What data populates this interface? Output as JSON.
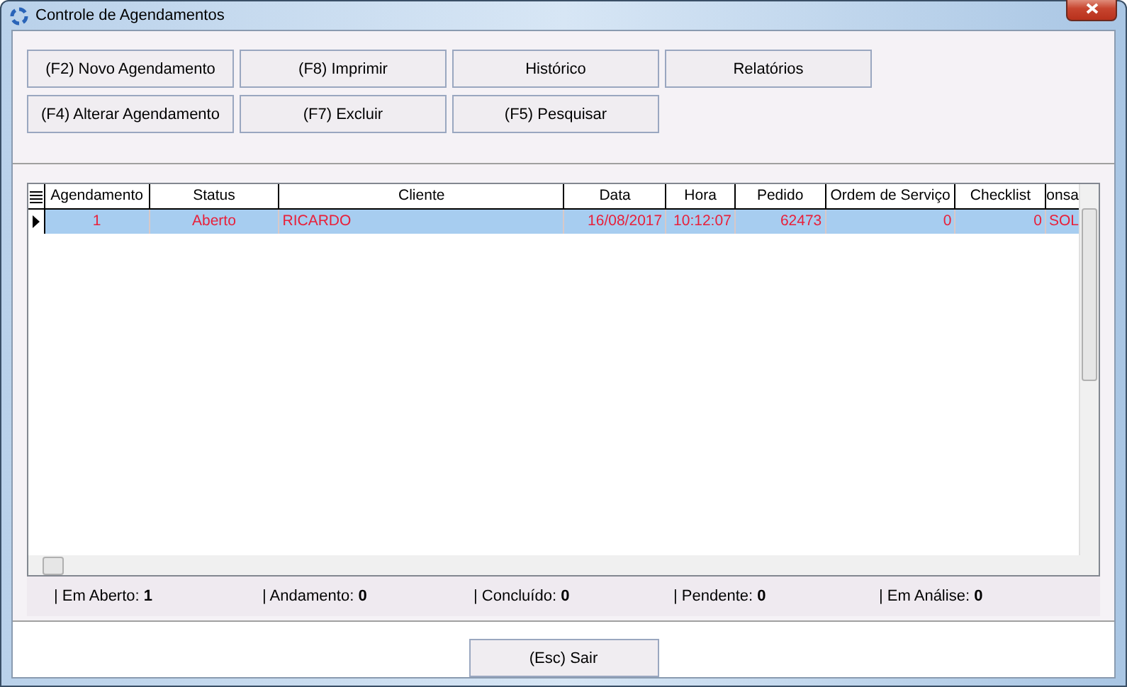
{
  "window": {
    "title": "Controle de Agendamentos"
  },
  "toolbar": [
    [
      {
        "label": "(F2) Novo Agendamento"
      },
      {
        "label": "(F8) Imprimir"
      },
      {
        "label": "Histórico"
      },
      {
        "label": "Relatórios"
      }
    ],
    [
      {
        "label": "(F4) Alterar Agendamento"
      },
      {
        "label": "(F7) Excluir"
      },
      {
        "label": "(F5) Pesquisar"
      }
    ]
  ],
  "table": {
    "columns": [
      "Agendamento",
      "Status",
      "Cliente",
      "Data",
      "Hora",
      "Pedido",
      "Ordem de Serviço",
      "Checklist",
      "onsa"
    ],
    "rows": [
      {
        "selected": true,
        "cells": [
          "1",
          "Aberto",
          "RICARDO",
          "16/08/2017",
          "10:12:07",
          "62473",
          "0",
          "0",
          "SOL"
        ]
      }
    ]
  },
  "status_bar": [
    {
      "label": "| Em Aberto:",
      "value": "1"
    },
    {
      "label": "| Andamento:",
      "value": "0"
    },
    {
      "label": "| Concluído:",
      "value": "0"
    },
    {
      "label": "| Pendente:",
      "value": "0"
    },
    {
      "label": "| Em Análise:",
      "value": "0"
    }
  ],
  "footer": {
    "button": "(Esc) Sair"
  }
}
